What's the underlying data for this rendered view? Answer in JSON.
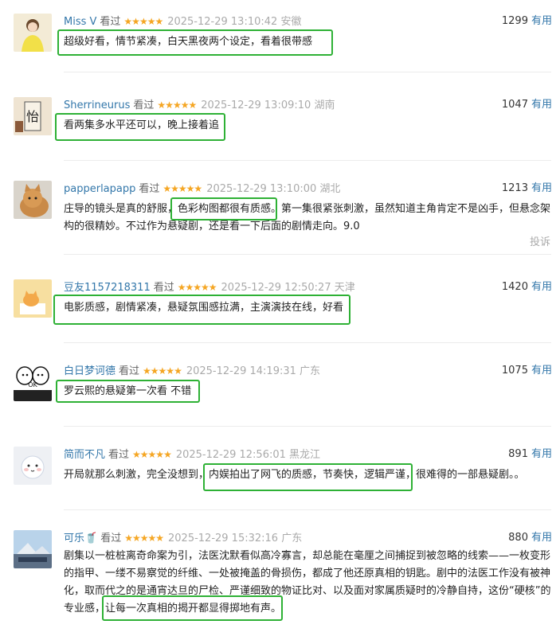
{
  "watched_label": "看过",
  "useful_label": "有用",
  "stars": "★★★★★",
  "reviews": [
    {
      "user": "Miss V",
      "date": "2025-12-29 13:10:42",
      "location": "安徽",
      "votes": "1299",
      "lines": [
        "超级好看，情节紧凑，白天黑夜两个设定，看着很带感"
      ]
    },
    {
      "user": "Sherrineurus",
      "date": "2025-12-29 13:09:10",
      "location": "湖南",
      "votes": "1047",
      "lines": [
        "看两集多水平还可以，晚上接着追"
      ]
    },
    {
      "user": "papperlapapp",
      "date": "2025-12-29 13:10:00",
      "location": "湖北",
      "votes": "1213",
      "lines": [
        "庄导的镜头是真的舒服，色彩构图都很有质感。第一集很紧张刺激，虽然知道主角肯定不是凶手，但悬念架",
        "构的很精妙。不过作为悬疑剧，还是看一下后面的剧情走向。9.0"
      ],
      "complain": "投诉"
    },
    {
      "user": "豆友1157218311",
      "date": "2025-12-29 12:50:27",
      "location": "天津",
      "votes": "1420",
      "lines": [
        "电影质感，剧情紧凑，悬疑氛围感拉满，主演演技在线，好看"
      ]
    },
    {
      "user": "白日梦诃德",
      "date": "2025-12-29 14:19:31",
      "location": "广东",
      "votes": "1075",
      "lines": [
        "罗云熙的悬疑第一次看 不错"
      ]
    },
    {
      "user": "简而不凡",
      "date": "2025-12-29 12:56:01",
      "location": "黑龙江",
      "votes": "891",
      "lines": [
        "开局就那么刺激，完全没想到，内娱拍出了网飞的质感，节奏快，逻辑严谨，很难得的一部悬疑剧。。"
      ]
    },
    {
      "user": "可乐🥤",
      "date": "2025-12-29 15:32:16",
      "location": "广东",
      "votes": "880",
      "lines": [
        "剧集以一桩桩离奇命案为引，法医沈默看似高冷寡言，却总能在毫厘之间捕捉到被忽略的线索——一枚变形",
        "的指甲、一缕不易察觉的纤维、一处被掩盖的骨损伤，都成了他还原真相的钥匙。剧中的法医工作没有被神",
        "化，取而代之的是通宵达旦的尸检、严谨细致的物证比对、以及面对家属质疑时的冷静自持，这份“硬核”的",
        "专业感，让每一次真相的揭开都显得掷地有声。"
      ]
    }
  ],
  "colors": {
    "link": "#3377aa",
    "star": "#f5a623",
    "highlight": "#2eb135",
    "meta": "#aaaaaa"
  }
}
